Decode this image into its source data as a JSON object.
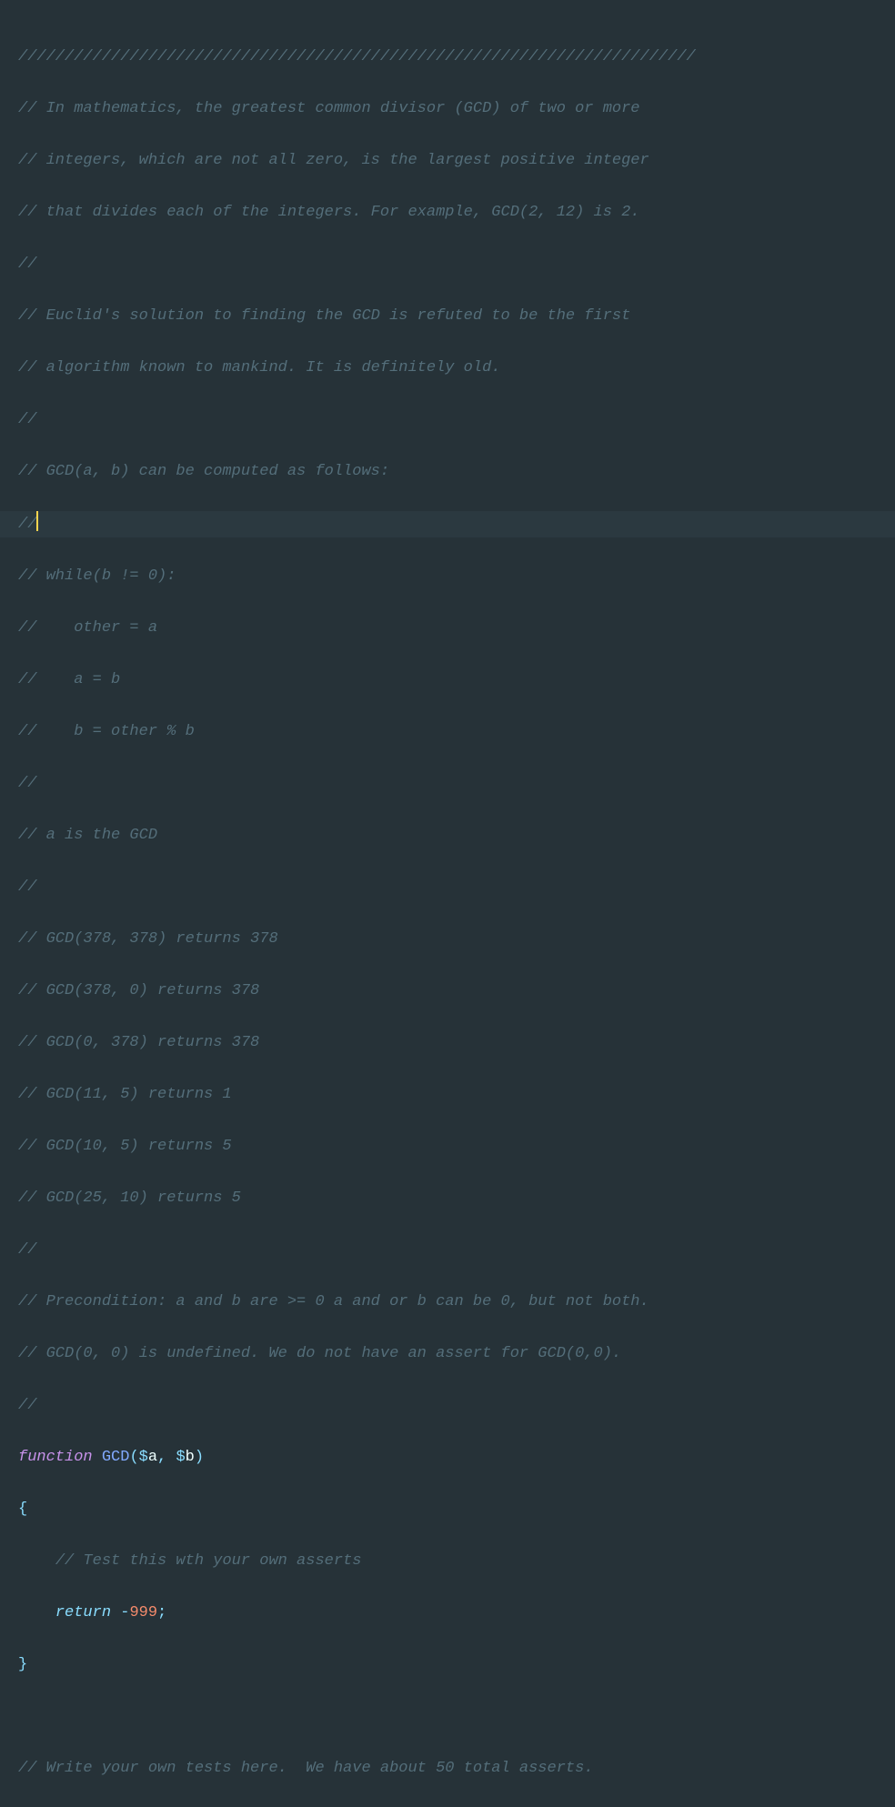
{
  "code": {
    "lines": [
      "/////////////////////////////////////////////////////////////////////////",
      "// In mathematics, the greatest common divisor (GCD) of two or more",
      "// integers, which are not all zero, is the largest positive integer",
      "// that divides each of the integers. For example, GCD(2, 12) is 2.",
      "//",
      "// Euclid's solution to finding the GCD is refuted to be the first",
      "// algorithm known to mankind. It is definitely old.",
      "//",
      "// GCD(a, b) can be computed as follows:",
      "//",
      "// while(b != 0):",
      "//    other = a",
      "//    a = b",
      "//    b = other % b",
      "//",
      "// a is the GCD",
      "//",
      "// GCD(378, 378) returns 378",
      "// GCD(378, 0) returns 378",
      "// GCD(0, 378) returns 378",
      "// GCD(11, 5) returns 1",
      "// GCD(10, 5) returns 5",
      "// GCD(25, 10) returns 5",
      "//",
      "// Precondition: a and b are >= 0 a and or b can be 0, but not both.",
      "// GCD(0, 0) is undefined. We do not have an assert for GCD(0,0).",
      "//"
    ],
    "func": {
      "keyword": "function",
      "name": "GCD",
      "param1": "a",
      "param2": "b",
      "commentInside": "// Test this wth your own asserts",
      "returnKeyword": "return",
      "returnValue": "999"
    },
    "trailingComment": "// Write your own tests here.  We have about 50 total asserts."
  },
  "colors": {
    "background": "#263238",
    "comment": "#546e7a",
    "keyword": "#c792ea",
    "function": "#82aaff",
    "operator": "#89ddff",
    "variable": "#eeffff",
    "number": "#f78c6c",
    "cursor": "#ffd54f",
    "highlightLine": "#2b3940"
  }
}
